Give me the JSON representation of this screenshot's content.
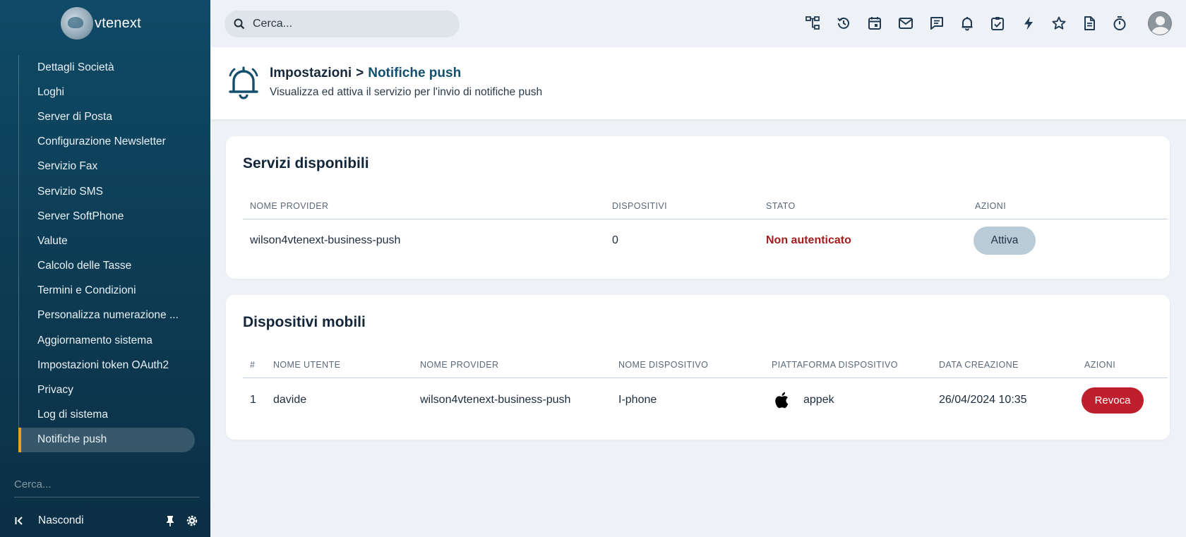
{
  "app": {
    "brand": "vtenext"
  },
  "sidebar": {
    "items": [
      {
        "label": "Dettagli Società"
      },
      {
        "label": "Loghi"
      },
      {
        "label": "Server di Posta"
      },
      {
        "label": "Configurazione Newsletter"
      },
      {
        "label": "Servizio Fax"
      },
      {
        "label": "Servizio SMS"
      },
      {
        "label": "Server SoftPhone"
      },
      {
        "label": "Valute"
      },
      {
        "label": "Calcolo delle Tasse"
      },
      {
        "label": "Termini e Condizioni"
      },
      {
        "label": "Personalizza numerazione ..."
      },
      {
        "label": "Aggiornamento sistema"
      },
      {
        "label": "Impostazioni token OAuth2"
      },
      {
        "label": "Privacy"
      },
      {
        "label": "Log di sistema"
      },
      {
        "label": "Notifiche push",
        "active": true
      }
    ],
    "search_placeholder": "Cerca...",
    "hide_label": "Nascondi"
  },
  "topbar": {
    "search_placeholder": "Cerca...",
    "icons": [
      "hierarchy-icon",
      "history-icon",
      "calendar-icon",
      "mail-icon",
      "chat-icon",
      "bell-icon",
      "task-check-icon",
      "lightning-icon",
      "star-icon",
      "document-icon",
      "timer-icon"
    ]
  },
  "header": {
    "breadcrumb_root": "Impostazioni",
    "breadcrumb_sep": ">",
    "breadcrumb_current": "Notifiche push",
    "subtitle": "Visualizza ed attiva il servizio per l'invio di notifiche push"
  },
  "services": {
    "title": "Servizi disponibili",
    "columns": [
      "NOME PROVIDER",
      "DISPOSITIVI",
      "STATO",
      "AZIONI"
    ],
    "rows": [
      {
        "provider": "wilson4vtenext-business-push",
        "devices": "0",
        "status": "Non autenticato",
        "action": "Attiva"
      }
    ]
  },
  "devices": {
    "title": "Dispositivi mobili",
    "columns": [
      "#",
      "NOME UTENTE",
      "NOME PROVIDER",
      "NOME DISPOSITIVO",
      "PIATTAFORMA DISPOSITIVO",
      "DATA CREAZIONE",
      "AZIONI"
    ],
    "rows": [
      {
        "num": "1",
        "user": "davide",
        "provider": "wilson4vtenext-business-push",
        "device": "I-phone",
        "platform": "appek",
        "created": "26/04/2024 10:35",
        "action": "Revoca"
      }
    ]
  },
  "colors": {
    "sidebar": "#0f4a66",
    "accent": "#e8a21f",
    "danger": "#bf1f2d",
    "status_bad": "#a51c1c"
  }
}
